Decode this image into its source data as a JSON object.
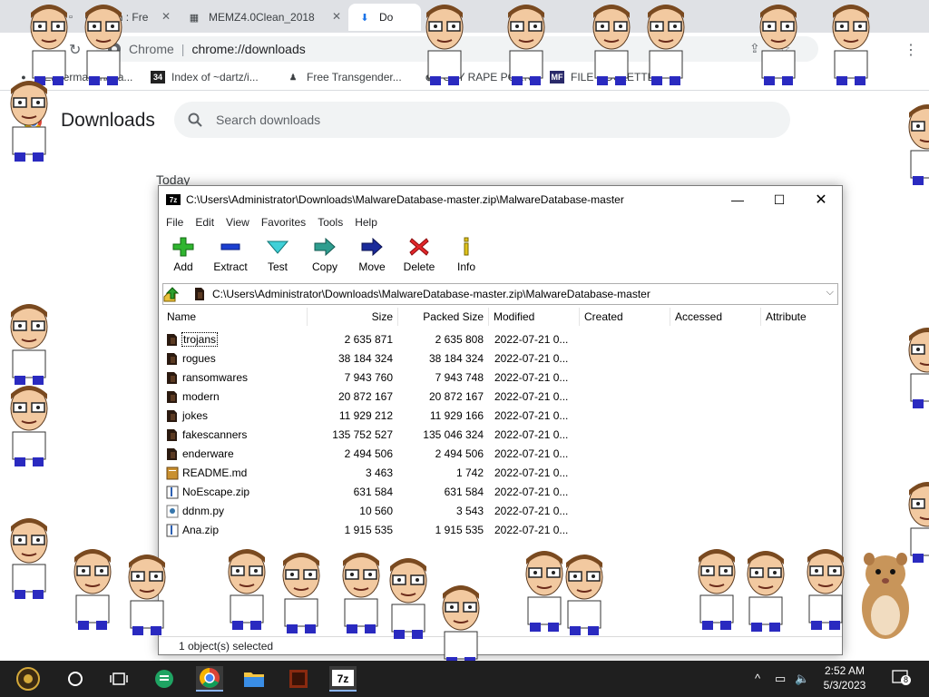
{
  "browser": {
    "tabs": [
      {
        "label": "0 Clean : Fre",
        "icon": "page-icon"
      },
      {
        "label": "MEMZ4.0Clean_2018",
        "icon": "document-icon"
      },
      {
        "label": "Do",
        "icon": "download-icon"
      }
    ],
    "omnibox": {
      "site": "Chrome",
      "separator": "|",
      "url": "chrome://downloads"
    },
    "bookmarks": [
      {
        "label": "- Endermanch/Ma...",
        "icon": "github-icon"
      },
      {
        "label": "Index of ~dartz/i...",
        "icon_text": "34",
        "icon": "site-icon"
      },
      {
        "label": "Free Transgender...",
        "icon": "pawn-icon"
      },
      {
        "label": "GAY RAPE PORN...",
        "icon": "globe-icon"
      },
      {
        "label": "FILE ROULETTE",
        "icon_text": "MF",
        "icon": "site-icon"
      }
    ]
  },
  "downloads": {
    "title": "Downloads",
    "search_placeholder": "Search downloads",
    "section": "Today"
  },
  "zip": {
    "title": "C:\\Users\\Administrator\\Downloads\\MalwareDatabase-master.zip\\MalwareDatabase-master",
    "logo": "7z",
    "menu": [
      "File",
      "Edit",
      "View",
      "Favorites",
      "Tools",
      "Help"
    ],
    "tools": [
      {
        "label": "Add",
        "icon": "plus-icon"
      },
      {
        "label": "Extract",
        "icon": "minus-icon"
      },
      {
        "label": "Test",
        "icon": "check-arrow-icon"
      },
      {
        "label": "Copy",
        "icon": "copy-arrow-icon"
      },
      {
        "label": "Move",
        "icon": "move-arrow-icon"
      },
      {
        "label": "Delete",
        "icon": "x-icon"
      },
      {
        "label": "Info",
        "icon": "info-icon"
      }
    ],
    "path": "C:\\Users\\Administrator\\Downloads\\MalwareDatabase-master.zip\\MalwareDatabase-master",
    "columns": [
      "Name",
      "Size",
      "Packed Size",
      "Modified",
      "Created",
      "Accessed",
      "Attribute"
    ],
    "rows": [
      {
        "name": "trojans",
        "size": "2 635 871",
        "packed": "2 635 808",
        "modified": "2022-07-21 0...",
        "type": "folder"
      },
      {
        "name": "rogues",
        "size": "38 184 324",
        "packed": "38 184 324",
        "modified": "2022-07-21 0...",
        "type": "folder"
      },
      {
        "name": "ransomwares",
        "size": "7 943 760",
        "packed": "7 943 748",
        "modified": "2022-07-21 0...",
        "type": "folder"
      },
      {
        "name": "modern",
        "size": "20 872 167",
        "packed": "20 872 167",
        "modified": "2022-07-21 0...",
        "type": "folder"
      },
      {
        "name": "jokes",
        "size": "11 929 212",
        "packed": "11 929 166",
        "modified": "2022-07-21 0...",
        "type": "folder"
      },
      {
        "name": "fakescanners",
        "size": "135 752 527",
        "packed": "135 046 324",
        "modified": "2022-07-21 0...",
        "type": "folder"
      },
      {
        "name": "enderware",
        "size": "2 494 506",
        "packed": "2 494 506",
        "modified": "2022-07-21 0...",
        "type": "folder"
      },
      {
        "name": "README.md",
        "size": "3 463",
        "packed": "1 742",
        "modified": "2022-07-21 0...",
        "type": "file"
      },
      {
        "name": "NoEscape.zip",
        "size": "631 584",
        "packed": "631 584",
        "modified": "2022-07-21 0...",
        "type": "zip"
      },
      {
        "name": "ddnm.py",
        "size": "10 560",
        "packed": "3 543",
        "modified": "2022-07-21 0...",
        "type": "py"
      },
      {
        "name": "Ana.zip",
        "size": "1 915 535",
        "packed": "1 915 535",
        "modified": "2022-07-21 0...",
        "type": "zip"
      }
    ],
    "status": "1 object(s) selected"
  },
  "taskbar": {
    "time": "2:52 AM",
    "date": "5/3/2023",
    "notifications": "8",
    "apps": [
      "start-icon",
      "cortana-icon",
      "task-view-icon",
      "sheets-icon",
      "chrome-icon",
      "file-explorer-icon",
      "app-icon",
      "7zip-icon"
    ]
  },
  "colors": {
    "accent": "#1a73e8",
    "taskbar": "#1f1f1f",
    "folder": "#2b1a10"
  }
}
